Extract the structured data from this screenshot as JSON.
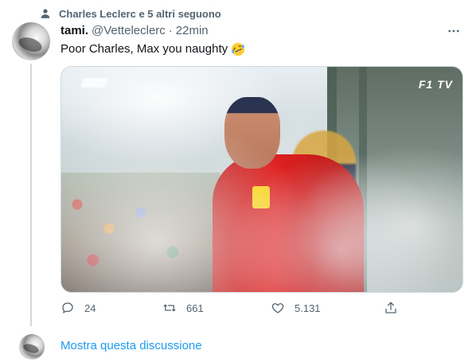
{
  "social_context": {
    "text": "Charles Leclerc e 5 altri seguono",
    "icon": "person-icon"
  },
  "tweet": {
    "author_name": "tami.",
    "handle": "@Vetteleclerc",
    "separator": "·",
    "time": "22min",
    "text": "Poor Charles, Max you naughty",
    "emoji": "rolling-on-floor-laughing",
    "more_icon": "more-horizontal-icon"
  },
  "media": {
    "overlay_text": "TV",
    "description_icon": "f1-logo"
  },
  "actions": {
    "reply_count": "24",
    "retweet_count": "661",
    "like_count": "5.131"
  },
  "thread": {
    "show_label": "Mostra questa discussione"
  },
  "colors": {
    "accent": "#1d9bf0",
    "muted": "#536471",
    "text": "#0f1419",
    "line": "#cfd9de"
  }
}
